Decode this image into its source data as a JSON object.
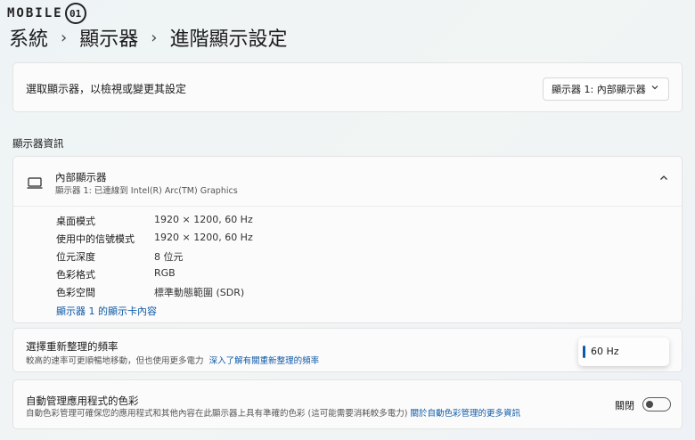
{
  "watermark": {
    "text": "MOBILE",
    "icon_glyph": "01"
  },
  "breadcrumb": {
    "items": [
      "系統",
      "顯示器",
      "進階顯示設定"
    ],
    "separator": "›"
  },
  "display_select": {
    "label": "選取顯示器，以檢視或變更其設定",
    "selected": "顯示器 1: 內部顯示器",
    "chevron_icon": "chevron-down-icon"
  },
  "display_info": {
    "section_title": "顯示器資訊",
    "monitor": {
      "title": "內部顯示器",
      "subtitle": "顯示器 1: 已連線到 Intel(R) Arc(TM) Graphics",
      "icon": "monitor-icon",
      "collapse_icon": "chevron-up-icon"
    },
    "rows": [
      {
        "key": "桌面模式",
        "value": "1920 × 1200, 60 Hz"
      },
      {
        "key": "使用中的信號模式",
        "value": "1920 × 1200, 60 Hz"
      },
      {
        "key": "位元深度",
        "value": "8 位元"
      },
      {
        "key": "色彩格式",
        "value": "RGB"
      },
      {
        "key": "色彩空間",
        "value": "標準動態範圍 (SDR)"
      }
    ],
    "adapter_link": "顯示器 1 的顯示卡內容"
  },
  "refresh_rate": {
    "title": "選擇重新整理的頻率",
    "description": "較高的速率可更順暢地移動，但也使用更多電力",
    "link": "深入了解有關重新整理的頻率",
    "selected_option": "60 Hz"
  },
  "auto_color": {
    "title": "自動管理應用程式的色彩",
    "description": "自動色彩管理可確保您的應用程式和其他內容在此顯示器上具有準確的色彩 (這可能需要消耗較多電力)",
    "link": "關於自動色彩管理的更多資訊",
    "toggle_label": "關閉",
    "toggle_on": false
  },
  "colors": {
    "accent": "#0f5aa6",
    "card_bg": "#fbfbfb"
  }
}
